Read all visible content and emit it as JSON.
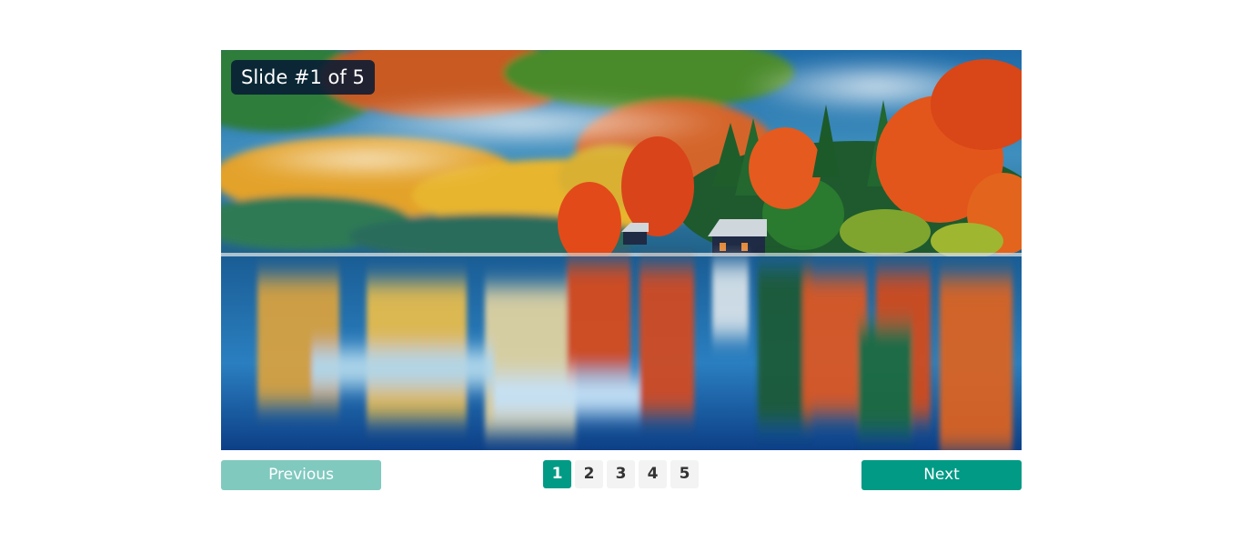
{
  "slider": {
    "caption": "Slide #1 of 5",
    "image_subject": "autumn lake landscape with boathouse and colorful forest reflection",
    "previous_label": "Previous",
    "next_label": "Next",
    "active_page": 1,
    "pages": [
      "1",
      "2",
      "3",
      "4",
      "5"
    ]
  },
  "colors": {
    "accent": "#009a85",
    "accent_disabled": "#80c9bf",
    "caption_bg": "#061834",
    "page_bg": "#f3f3f3"
  }
}
